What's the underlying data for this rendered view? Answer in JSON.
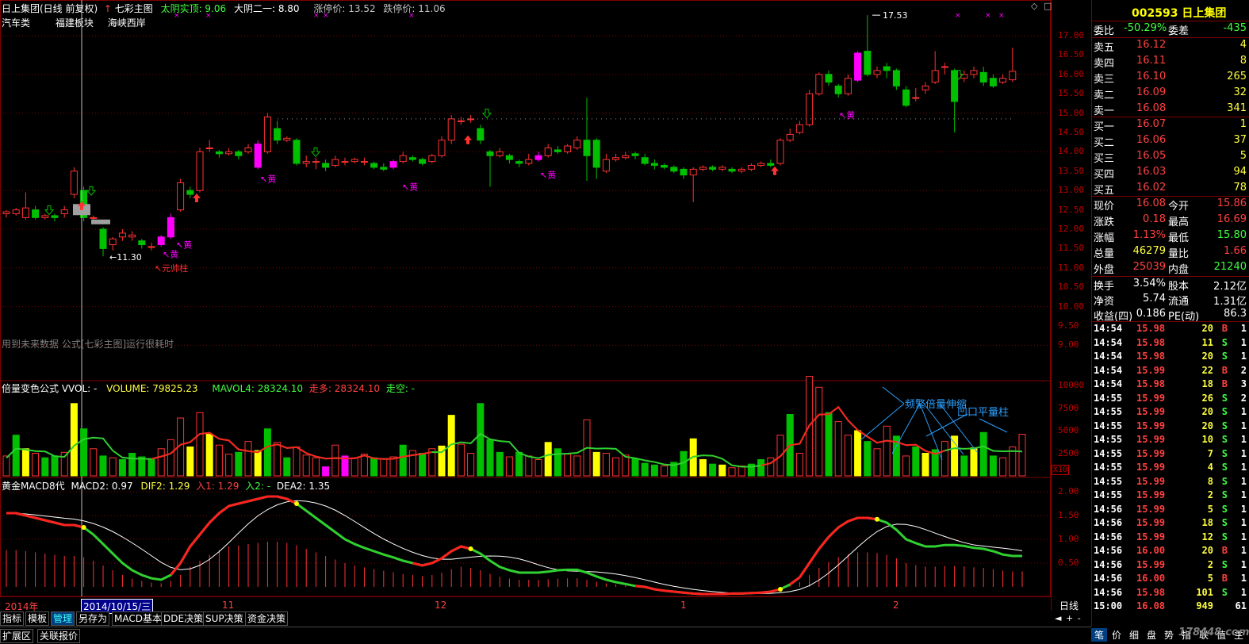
{
  "main": {
    "title": "日上集团(日线 前复权)",
    "indicator_name": "七彩主图",
    "ind1": "太阴实顶: 9.06",
    "ind2": "大阴二一: 8.80",
    "limit_up": "涨停价: 13.52",
    "limit_down": "跌停价: 11.06",
    "tags": [
      "汽车类",
      "福建板块",
      "海峡西岸"
    ],
    "warning": "用到未来数据 公式[七彩主图]运行很耗时",
    "price_axis": [
      "17.00",
      "16.50",
      "16.00",
      "15.50",
      "15.00",
      "14.50",
      "14.00",
      "13.50",
      "13.00",
      "12.50",
      "12.00",
      "11.50",
      "11.00",
      "10.50",
      "10.00",
      "9.50",
      "9.00"
    ],
    "high_label": "17.53",
    "low_label": "11.30",
    "annot_red": "元帅柱",
    "annot_yellow": "黄",
    "annot_yellow2": "黄",
    "annot_huang": [
      "黄",
      "黄",
      "黄",
      "黄"
    ]
  },
  "volume": {
    "title": "倍量变色公式 VVOL: -",
    "volume": "VOLUME: 79825.23",
    "mavol": "MAVOL4: 28324.10",
    "zouduo": "走多: 28324.10",
    "zoukong": "走空: -",
    "axis": [
      "10000",
      "7500",
      "5000",
      "2500"
    ],
    "unit": "X10",
    "annot1": "频繁倍量伸缩",
    "annot2": "凹口平量柱"
  },
  "macd": {
    "title": "黄金MACD8代",
    "macd2": "MACD2: 0.97",
    "dif2": "DIF2: 1.29",
    "ru1": "入1: 1.29",
    "ru2": "入2: -",
    "dea2": "DEA2: 1.35",
    "axis": [
      "2.00",
      "1.50",
      "1.00",
      "0.50"
    ]
  },
  "dates": {
    "year": "2014年",
    "cursor": "2014/10/15/三",
    "months": [
      "11",
      "12",
      "1",
      "2"
    ],
    "period": "日线"
  },
  "bottom_tabs": [
    "指标",
    "模板",
    "管理",
    "另存为",
    "MACD基本",
    "DDE决策",
    "SUP决策",
    "资金决策"
  ],
  "status_tabs": [
    "扩展区",
    "关联报价"
  ],
  "quote": {
    "code_name": "002593 日上集团",
    "weibi_label": "委比",
    "weibi": "-50.29%",
    "weicha_label": "委差",
    "weicha": "-435",
    "sells": [
      {
        "label": "卖五",
        "price": "16.12",
        "vol": "4"
      },
      {
        "label": "卖四",
        "price": "16.11",
        "vol": "8"
      },
      {
        "label": "卖三",
        "price": "16.10",
        "vol": "265"
      },
      {
        "label": "卖二",
        "price": "16.09",
        "vol": "32"
      },
      {
        "label": "卖一",
        "price": "16.08",
        "vol": "341"
      }
    ],
    "buys": [
      {
        "label": "买一",
        "price": "16.07",
        "vol": "1"
      },
      {
        "label": "买二",
        "price": "16.06",
        "vol": "37"
      },
      {
        "label": "买三",
        "price": "16.05",
        "vol": "5"
      },
      {
        "label": "买四",
        "price": "16.03",
        "vol": "94"
      },
      {
        "label": "买五",
        "price": "16.02",
        "vol": "78"
      }
    ],
    "stats": [
      {
        "l1": "现价",
        "v1": "16.08",
        "l2": "今开",
        "v2": "15.86",
        "c1": "red",
        "c2": "red"
      },
      {
        "l1": "涨跌",
        "v1": "0.18",
        "l2": "最高",
        "v2": "16.69",
        "c1": "red",
        "c2": "red"
      },
      {
        "l1": "涨幅",
        "v1": "1.13%",
        "l2": "最低",
        "v2": "15.80",
        "c1": "red",
        "c2": "green"
      },
      {
        "l1": "总量",
        "v1": "46279",
        "l2": "量比",
        "v2": "1.66",
        "c1": "yellow",
        "c2": "red"
      },
      {
        "l1": "外盘",
        "v1": "25039",
        "l2": "内盘",
        "v2": "21240",
        "c1": "red",
        "c2": "green"
      }
    ],
    "stats2": [
      {
        "l1": "换手",
        "v1": "3.54%",
        "l2": "股本",
        "v2": "2.12亿"
      },
      {
        "l1": "净资",
        "v1": "5.74",
        "l2": "流通",
        "v2": "1.31亿"
      },
      {
        "l1": "收益(四)",
        "v1": "0.186",
        "l2": "PE(动)",
        "v2": "86.3"
      }
    ],
    "ticks": [
      {
        "t": "14:54",
        "p": "15.98",
        "v": "20",
        "bs": "B",
        "n": "1"
      },
      {
        "t": "14:54",
        "p": "15.98",
        "v": "11",
        "bs": "S",
        "n": "1"
      },
      {
        "t": "14:54",
        "p": "15.98",
        "v": "20",
        "bs": "S",
        "n": "1"
      },
      {
        "t": "14:54",
        "p": "15.99",
        "v": "22",
        "bs": "B",
        "n": "2"
      },
      {
        "t": "14:54",
        "p": "15.98",
        "v": "18",
        "bs": "B",
        "n": "3"
      },
      {
        "t": "14:55",
        "p": "15.99",
        "v": "26",
        "bs": "S",
        "n": "2"
      },
      {
        "t": "14:55",
        "p": "15.99",
        "v": "20",
        "bs": "S",
        "n": "1"
      },
      {
        "t": "14:55",
        "p": "15.99",
        "v": "20",
        "bs": "S",
        "n": "1"
      },
      {
        "t": "14:55",
        "p": "15.99",
        "v": "10",
        "bs": "S",
        "n": "1"
      },
      {
        "t": "14:55",
        "p": "15.99",
        "v": "7",
        "bs": "S",
        "n": "1"
      },
      {
        "t": "14:55",
        "p": "15.99",
        "v": "4",
        "bs": "S",
        "n": "1"
      },
      {
        "t": "14:55",
        "p": "15.99",
        "v": "8",
        "bs": "S",
        "n": "1"
      },
      {
        "t": "14:55",
        "p": "15.99",
        "v": "2",
        "bs": "S",
        "n": "1"
      },
      {
        "t": "14:56",
        "p": "15.99",
        "v": "5",
        "bs": "S",
        "n": "1"
      },
      {
        "t": "14:56",
        "p": "15.99",
        "v": "18",
        "bs": "S",
        "n": "1"
      },
      {
        "t": "14:56",
        "p": "15.99",
        "v": "12",
        "bs": "S",
        "n": "1"
      },
      {
        "t": "14:56",
        "p": "16.00",
        "v": "20",
        "bs": "B",
        "n": "1"
      },
      {
        "t": "14:56",
        "p": "15.99",
        "v": "2",
        "bs": "S",
        "n": "1"
      },
      {
        "t": "14:56",
        "p": "16.00",
        "v": "5",
        "bs": "B",
        "n": "1"
      },
      {
        "t": "14:56",
        "p": "15.98",
        "v": "101",
        "bs": "S",
        "n": "1"
      },
      {
        "t": "15:00",
        "p": "16.08",
        "v": "949",
        "bs": "",
        "n": "61"
      }
    ],
    "bottom_tabs": [
      "笔",
      "价",
      "细",
      "盘",
      "势",
      "指",
      "联",
      "值",
      "主"
    ]
  },
  "watermark": "178448.com",
  "colors": {
    "up": "#ff3232",
    "down": "#00c000",
    "yellow": "#ffff00",
    "magenta": "#ff00ff",
    "grid": "#800000",
    "blue": "#2aa0ff"
  }
}
